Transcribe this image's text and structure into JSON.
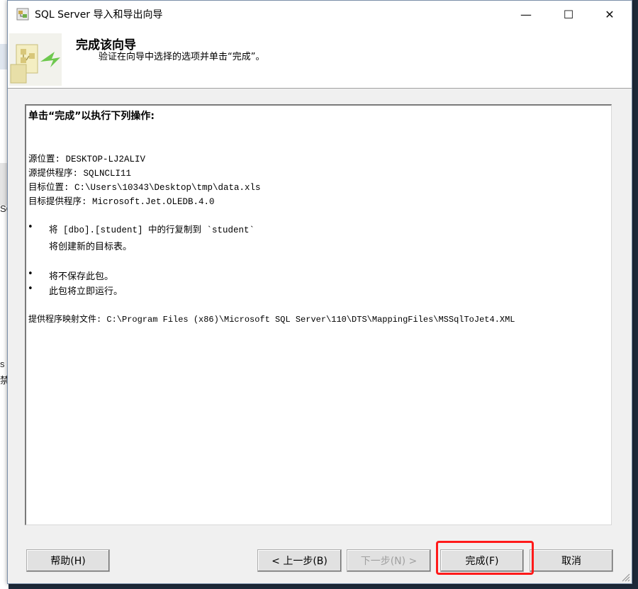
{
  "background_app": {
    "fragments": [
      "SQL",
      "s",
      "禁"
    ]
  },
  "window": {
    "title": "SQL Server 导入和导出向导",
    "controls": {
      "minimize": "—",
      "maximize": "☐",
      "close": "✕"
    }
  },
  "header": {
    "title": "完成该向导",
    "subtitle": "验证在向导中选择的选项并单击“完成”。"
  },
  "summary": {
    "heading": "单击“完成”以执行下列操作:",
    "source_location": "源位置: DESKTOP-LJ2ALIV",
    "source_provider": "源提供程序: SQLNCLI11",
    "dest_location": "目标位置: C:\\Users\\10343\\Desktop\\tmp\\data.xls",
    "dest_provider": "目标提供程序: Microsoft.Jet.OLEDB.4.0",
    "bullet": "•",
    "copy_action": "将 [dbo].[student] 中的行复制到 `student`",
    "create_table": "将创建新的目标表。",
    "not_save": "将不保存此包。",
    "run_now": "此包将立即运行。",
    "mapping_file": "提供程序映射文件: C:\\Program Files (x86)\\Microsoft SQL Server\\110\\DTS\\MappingFiles\\MSSqlToJet4.XML"
  },
  "buttons": {
    "help": "帮助(H)",
    "back": "< 上一步(B)",
    "next": "下一步(N) >",
    "finish": "完成(F)",
    "cancel": "取消"
  },
  "colors": {
    "highlight": "#ff1a1a",
    "window_border": "#7a8ea8"
  }
}
